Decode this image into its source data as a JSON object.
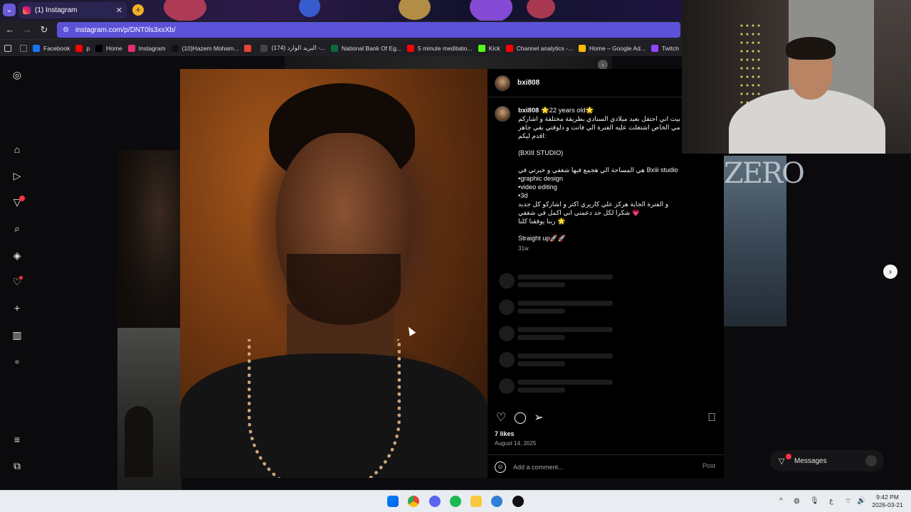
{
  "browser": {
    "tab_title": "(1) Instagram",
    "tab_close": "✕",
    "new_tab": "+",
    "url": "instagram.com/p/DNT0ls3xxXb/",
    "bookmarks": [
      {
        "label": "Facebook",
        "color": "#1877f2"
      },
      {
        "label": "p",
        "color": "#ff0000"
      },
      {
        "label": "Home",
        "color": "#000000"
      },
      {
        "label": "Instagram",
        "color": "#e1306c"
      },
      {
        "label": "(10)Hazem Moham...",
        "color": "#111111"
      },
      {
        "label": "",
        "color": "#ea4335"
      },
      {
        "label": "(174) البريد الوارد -...",
        "color": "#444444"
      },
      {
        "label": "National Bank Of Eg...",
        "color": "#0b6b3a"
      },
      {
        "label": "5 minute meditatio...",
        "color": "#ff0000"
      },
      {
        "label": "Kick",
        "color": "#53fc18"
      },
      {
        "label": "Channel analytics -...",
        "color": "#ff0000"
      },
      {
        "label": "Home – Google Ad...",
        "color": "#fbbc04"
      },
      {
        "label": "Twitch",
        "color": "#9146ff"
      }
    ]
  },
  "post": {
    "username": "bxi808",
    "caption_user": "bxi808",
    "age_line": "🌟22 years old🌟",
    "caption_lines": [
      "بيت اني احتفل بعيد ميلادي السنادي بطريقة مختلفة و اشاركم",
      "مي الخاص اشتغلت عليه الفترة الي فاتت و دلوقتي بقي جاهز",
      ":اقدم ليكم",
      "",
      "(BXIII STUDIO)",
      "",
      "Bxiii studio هي المساحة الي هجمع فيها شغفي و خبرتي في",
      "•graphic design",
      "•video editing",
      "•3d",
      "و الفترة الجاية هركز علي كاريري اكتر و اشاركو كل جديد",
      "💗 شكرا لكل حد دعمني اني اكمل في شغفي",
      "🌟 ربنا يوفقنا كلنا",
      "",
      "Straight up🚀🚀"
    ],
    "timestamp": "31w",
    "likes": "7 likes",
    "date": "August 14, 2025",
    "comment_placeholder": "Add a comment...",
    "post_label": "Post"
  },
  "messages": {
    "label": "Messages"
  },
  "background_tile_text": "ZERO",
  "taskbar": {
    "time": "9:42 PM",
    "date": "2026-03-21",
    "lang": "ع"
  },
  "colors": {
    "url_bar": "#5c52d8",
    "notification": "#ff3040",
    "panel_bg": "#000000"
  }
}
